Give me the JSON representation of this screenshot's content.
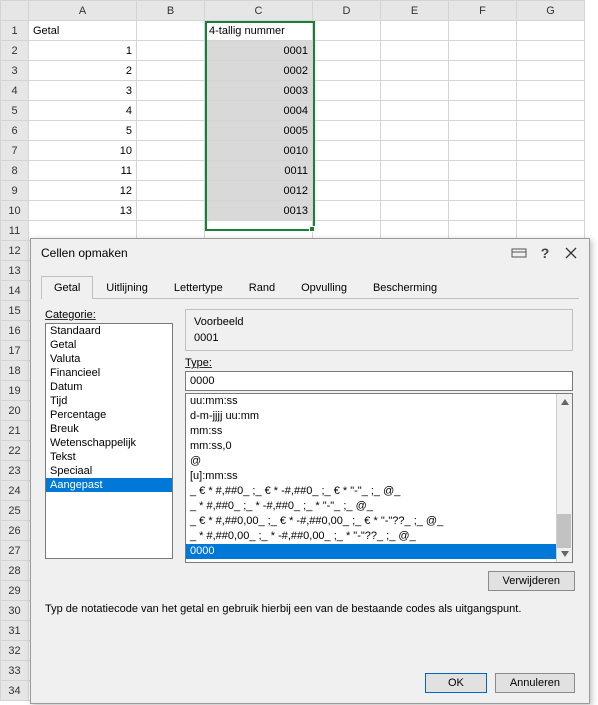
{
  "sheet": {
    "cols": [
      "A",
      "B",
      "C",
      "D",
      "E",
      "F",
      "G"
    ],
    "header": {
      "A": "Getal",
      "C": "4-tallig nummer"
    },
    "rows": [
      {
        "n": 1
      },
      {
        "n": 2,
        "A": "1",
        "C": "0001"
      },
      {
        "n": 3,
        "A": "2",
        "C": "0002"
      },
      {
        "n": 4,
        "A": "3",
        "C": "0003"
      },
      {
        "n": 5,
        "A": "4",
        "C": "0004"
      },
      {
        "n": 6,
        "A": "5",
        "C": "0005"
      },
      {
        "n": 7,
        "A": "10",
        "C": "0010"
      },
      {
        "n": 8,
        "A": "11",
        "C": "0011"
      },
      {
        "n": 9,
        "A": "12",
        "C": "0012"
      },
      {
        "n": 10,
        "A": "13",
        "C": "0013"
      }
    ],
    "blank_rows": [
      11,
      12,
      13,
      14,
      15,
      16,
      17,
      18,
      19,
      20,
      21,
      22,
      23,
      24,
      25,
      26,
      27,
      28,
      29,
      30,
      31,
      32,
      33,
      34
    ]
  },
  "dialog": {
    "title": "Cellen opmaken",
    "tabs": [
      "Getal",
      "Uitlijning",
      "Lettertype",
      "Rand",
      "Opvulling",
      "Bescherming"
    ],
    "active_tab": 0,
    "category_label": "Categorie:",
    "categories": [
      "Standaard",
      "Getal",
      "Valuta",
      "Financieel",
      "Datum",
      "Tijd",
      "Percentage",
      "Breuk",
      "Wetenschappelijk",
      "Tekst",
      "Speciaal",
      "Aangepast"
    ],
    "selected_category": 11,
    "preview_label": "Voorbeeld",
    "preview_value": "0001",
    "type_label": "Type:",
    "type_value": "0000",
    "formats": [
      "uu:mm:ss",
      "d-m-jjjj uu:mm",
      "mm:ss",
      "mm:ss,0",
      "@",
      "[u]:mm:ss",
      "_ € * #,##0_ ;_ € * -#,##0_ ;_ € * \"-\"_ ;_ @_",
      "_ * #,##0_ ;_ * -#,##0_ ;_ * \"-\"_ ;_ @_",
      "_ € * #,##0,00_ ;_ € * -#,##0,00_ ;_ € * \"-\"??_ ;_ @_",
      "_ * #,##0,00_ ;_ * -#,##0,00_ ;_ * \"-\"??_ ;_ @_",
      "0000"
    ],
    "selected_format": 10,
    "delete_label": "Verwijderen",
    "hint": "Typ de notatiecode van het getal en gebruik hierbij een van de bestaande codes als uitgangspunt.",
    "ok_label": "OK",
    "cancel_label": "Annuleren",
    "help_label": "?"
  }
}
